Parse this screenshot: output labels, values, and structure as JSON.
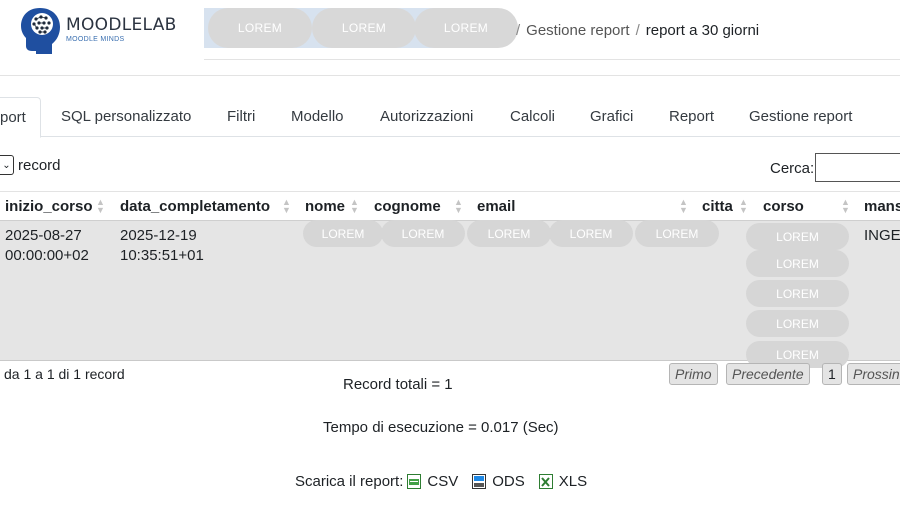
{
  "brand": {
    "name": "MOODLELAB",
    "tagline": "MOODLE MINDS"
  },
  "breadcrumb": {
    "masked": [
      "LOREM",
      "LOREM",
      "LOREM"
    ],
    "items": [
      "Gestione report",
      "report a 30 giorni"
    ],
    "separator": "/"
  },
  "tabs": [
    "port",
    "SQL personalizzato",
    "Filtri",
    "Modello",
    "Autorizzazioni",
    "Calcoli",
    "Grafici",
    "Report",
    "Gestione report"
  ],
  "controls": {
    "length_label": "record",
    "search_label": "Cerca:",
    "search_value": ""
  },
  "table": {
    "columns": [
      "inizio_corso",
      "data_completamento",
      "nome",
      "cognome",
      "email",
      "citta",
      "corso",
      "mans"
    ],
    "row": {
      "inizio_corso": [
        "2025-08-27",
        "00:00:00+02"
      ],
      "data_completamento": [
        "2025-12-19",
        "10:35:51+01"
      ],
      "masked_cells": [
        "LOREM",
        "LOREM",
        "LOREM",
        "LOREM",
        "LOREM"
      ],
      "corso_masked": [
        "LOREM",
        "LOREM",
        "LOREM",
        "LOREM",
        "LOREM"
      ],
      "mansione": "INGE"
    }
  },
  "footer": {
    "info": "da 1 a 1 di 1 record",
    "pager": [
      "Primo",
      "Precedente",
      "1",
      "Prossin"
    ],
    "total": "Record totali = 1",
    "exec_time": "Tempo di esecuzione = 0.017 (Sec)",
    "download_label": "Scarica il report:",
    "formats": [
      "CSV",
      "ODS",
      "XLS"
    ]
  },
  "colors": {
    "row_bg": "#e5e5e5",
    "mask_pill": "#d8d8d8",
    "breadcrumb_mask": "#d7e2ef"
  }
}
